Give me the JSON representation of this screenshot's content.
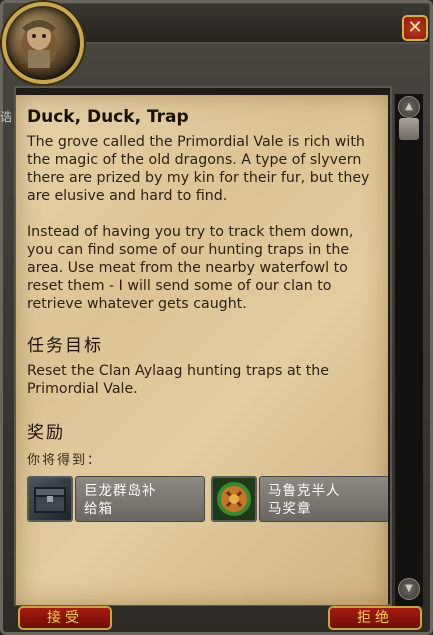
{
  "window": {
    "close_glyph": "✕"
  },
  "quest": {
    "title": "Duck, Duck, Trap",
    "description": "The grove called the Primordial Vale is rich with the magic of the old dragons. A type of slyvern there are prized by my kin for their fur, but they are elusive and hard to find.\n\nInstead of having you try to track them down, you can find some of our hunting traps in the area. Use meat from the nearby waterfowl to reset them - I will send some of our clan to retrieve whatever gets caught.",
    "objectives_heading": "任务目标",
    "objective_text": "Reset the Clan Aylaag hunting traps at the Primordial Vale.",
    "rewards_heading": "奖励",
    "rewards_subheading": "你将得到：",
    "rewards": [
      {
        "label_line1": "巨龙群岛补",
        "label_line2": "给箱",
        "icon": "supply-chest-icon"
      },
      {
        "label_line1": "马鲁克半人",
        "label_line2": "马奖章",
        "icon": "centaur-medal-icon"
      }
    ]
  },
  "buttons": {
    "accept": "接受",
    "decline": "拒绝"
  },
  "left_sliver_text": "诰"
}
